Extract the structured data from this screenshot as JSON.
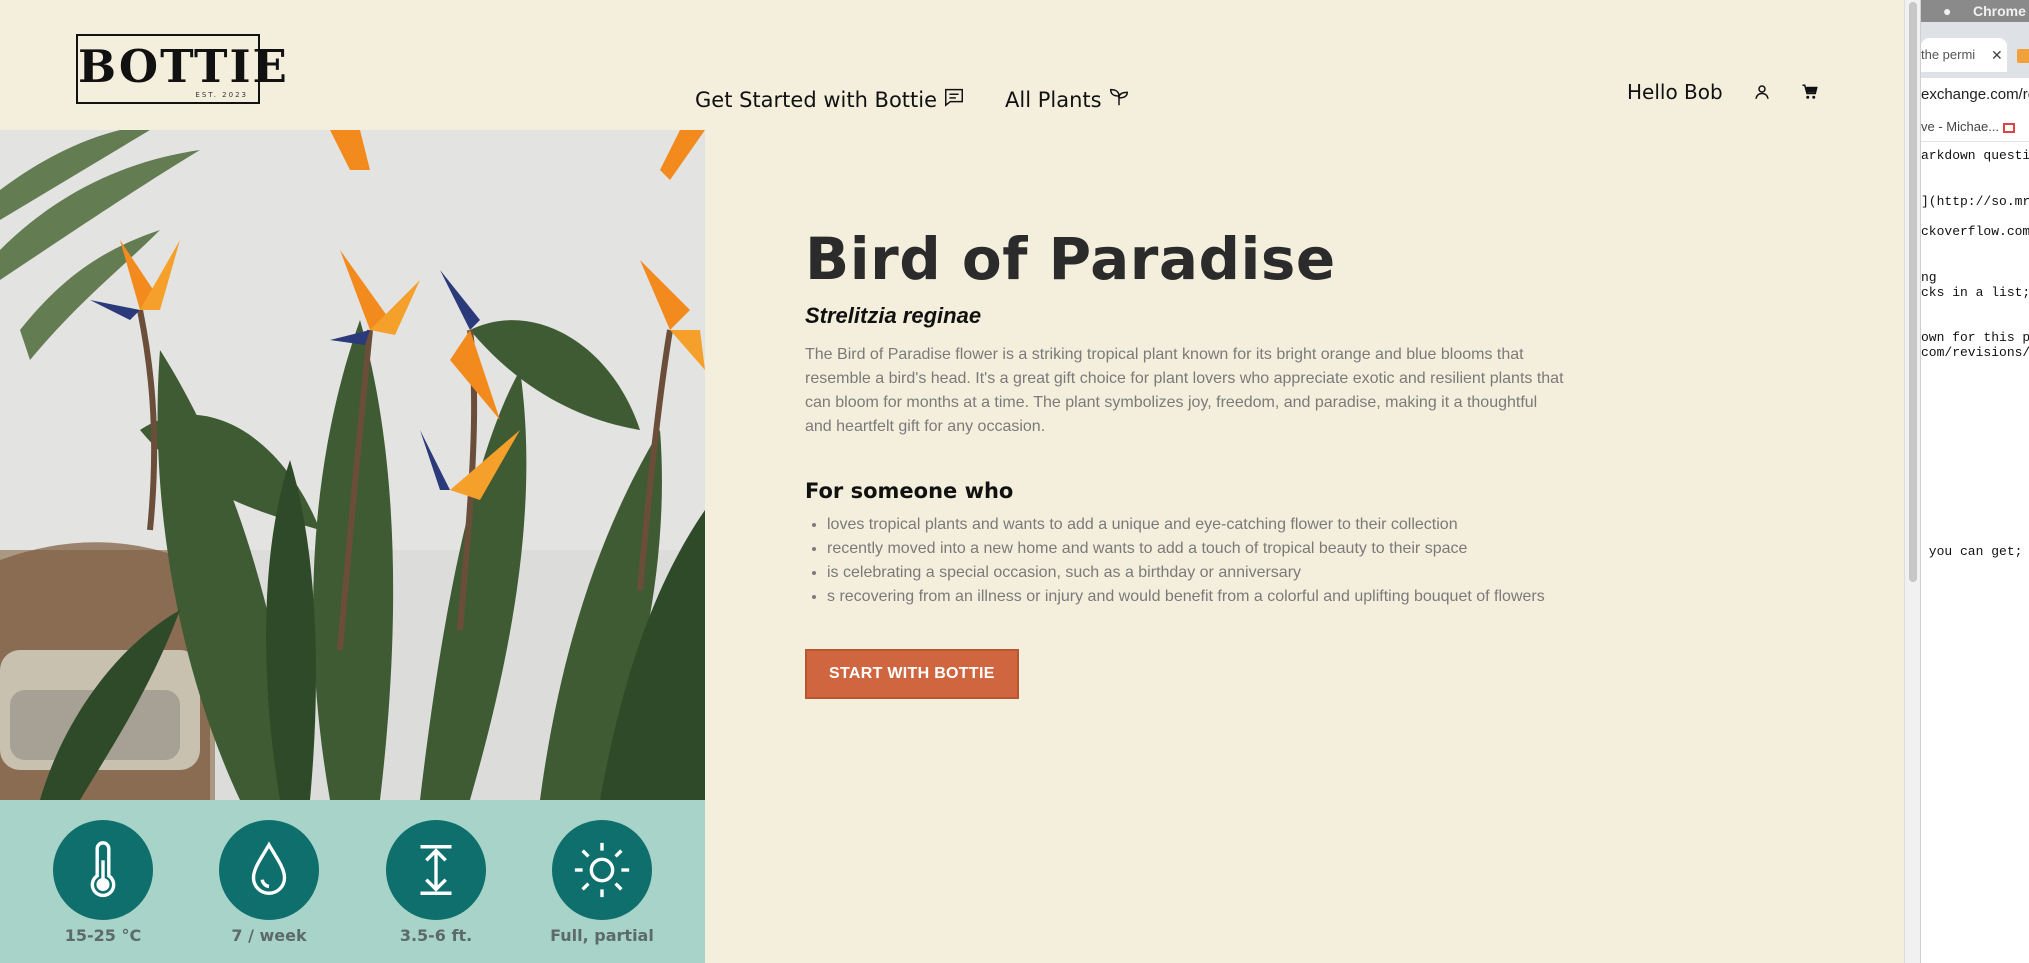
{
  "logo": {
    "text": "BOTTIE",
    "est": "EST. 2023"
  },
  "nav": {
    "get_started": "Get Started with Bottie",
    "all_plants": "All Plants"
  },
  "user": {
    "greeting": "Hello Bob"
  },
  "plant": {
    "name": "Bird of Paradise",
    "scientific_name": "Strelitzia reginae",
    "description": "The Bird of Paradise flower is a striking tropical plant known for its bright orange and blue blooms that resemble a bird's head. It's a great gift choice for plant lovers who appreciate exotic and resilient plants that can bloom for months at a time. The plant symbolizes joy, freedom, and paradise, making it a thoughtful and heartfelt gift for any occasion.",
    "for_someone_heading": "For someone who",
    "reasons": [
      "loves tropical plants and wants to add a unique and eye-catching flower to their collection",
      "recently moved into a new home and wants to add a touch of tropical beauty to their space",
      "is celebrating a special occasion, such as a birthday or anniversary",
      "s recovering from an illness or injury and would benefit from a colorful and uplifting bouquet of flowers"
    ],
    "cta": "START WITH BOTTIE"
  },
  "stats": [
    {
      "icon": "thermometer-icon",
      "label": "15-25 °C"
    },
    {
      "icon": "water-drop-icon",
      "label": "7 / week"
    },
    {
      "icon": "height-icon",
      "label": "3.5-6 ft."
    },
    {
      "icon": "sun-icon",
      "label": "Full, partial"
    }
  ],
  "colors": {
    "background": "#f4efdc",
    "accent": "#d0663f",
    "stat_panel": "#a7d3c8",
    "stat_circle": "#0e6f6c"
  },
  "other_window": {
    "menu_app": "Chrome",
    "tab_label": "the permi",
    "url": "exchange.com/re",
    "bookmark": "ve - Michae...",
    "code_lines": [
      "arkdown questi",
      "](http://so.mr",
      "ckoverflow.com",
      "ng",
      "cks in a list;",
      "own for this p",
      "com/revisions/",
      " you can get; "
    ]
  }
}
